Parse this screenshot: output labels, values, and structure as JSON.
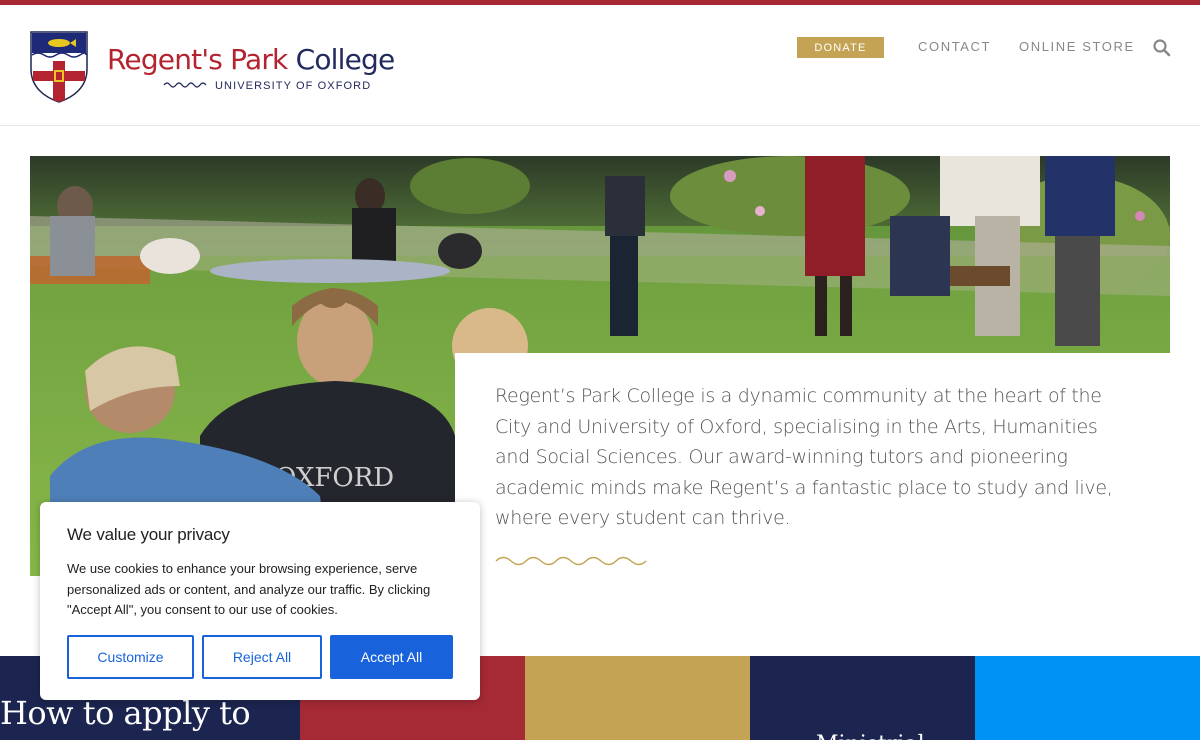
{
  "header": {
    "logo": {
      "name_red": "Regent's Park",
      "name_navy": "College",
      "subtitle": "UNIVERSITY OF OXFORD"
    },
    "nav": {
      "donate_label": "DONATE",
      "contact_label": "CONTACT",
      "store_label": "ONLINE STORE",
      "search_icon": "search-icon"
    }
  },
  "hero": {
    "image_subject": "students-on-lawn-photo"
  },
  "intro": {
    "text": "Regent’s Park College is a dynamic community at the heart of the City and University of Oxford, specialising in the Arts, Humanities and Social Sciences. Our award-winning tutors and pioneering academic minds make Regent’s a fantastic place to study and live, where every student can thrive."
  },
  "tiles": [
    {
      "title": "How to apply to",
      "color": "#1c2550"
    },
    {
      "title": "",
      "color": "#a52a36"
    },
    {
      "title": "",
      "color": "#c4a454"
    },
    {
      "title": "Ministrial",
      "color": "#1c2550"
    },
    {
      "title": "",
      "color": "#0092f5"
    }
  ],
  "cookie_banner": {
    "title": "We value your privacy",
    "body": "We use cookies to enhance your browsing experience, serve personalized ads or content, and analyze our traffic. By clicking \"Accept All\", you consent to our use of cookies.",
    "customize_label": "Customize",
    "reject_label": "Reject All",
    "accept_label": "Accept All"
  },
  "colors": {
    "brand_red": "#a52a36",
    "brand_navy": "#1c2550",
    "brand_gold": "#c4a454",
    "cookie_blue": "#1863dc"
  }
}
